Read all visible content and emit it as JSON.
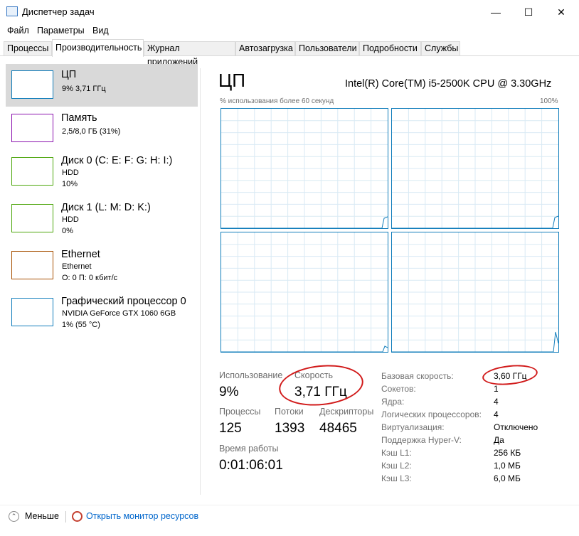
{
  "window": {
    "title": "Диспетчер задач",
    "controls": {
      "minimize": "—",
      "maximize": "☐",
      "close": "✕"
    }
  },
  "menu": [
    "Файл",
    "Параметры",
    "Вид"
  ],
  "tabs": [
    {
      "label": "Процессы",
      "active": false
    },
    {
      "label": "Производительность",
      "active": true
    },
    {
      "label": "Журнал приложений",
      "active": false
    },
    {
      "label": "Автозагрузка",
      "active": false
    },
    {
      "label": "Пользователи",
      "active": false
    },
    {
      "label": "Подробности",
      "active": false
    },
    {
      "label": "Службы",
      "active": false
    }
  ],
  "sidebar": [
    {
      "title": "ЦП",
      "lines": [
        "9% 3,71 ГГц"
      ],
      "color": "#117dbb",
      "selected": true
    },
    {
      "title": "Память",
      "lines": [
        "2,5/8,0 ГБ (31%)"
      ],
      "color": "#8b12ae",
      "selected": false
    },
    {
      "title": "Диск 0 (C: E: F: G: H: I:)",
      "lines": [
        "HDD",
        "10%"
      ],
      "color": "#4da60c",
      "selected": false
    },
    {
      "title": "Диск 1 (L: M: D: K:)",
      "lines": [
        "HDD",
        "0%"
      ],
      "color": "#4da60c",
      "selected": false
    },
    {
      "title": "Ethernet",
      "lines": [
        "Ethernet",
        "О: 0 П: 0 кбит/с"
      ],
      "color": "#a74f01",
      "selected": false
    },
    {
      "title": "Графический процессор 0",
      "lines": [
        "NVIDIA GeForce GTX 1060 6GB",
        "1% (55 °C)"
      ],
      "color": "#117dbb",
      "selected": false
    }
  ],
  "main": {
    "heading": "ЦП",
    "model": "Intel(R) Core(TM) i5-2500K CPU @ 3.30GHz",
    "graph_caption": "% использования более 60 секунд",
    "graph_max": "100%",
    "graph_color": "#117dbb",
    "graph_grid_color": "#d9eaf4",
    "stats": {
      "usage_label": "Использование",
      "usage_value": "9%",
      "speed_label": "Скорость",
      "speed_value": "3,71 ГГц",
      "processes_label": "Процессы",
      "processes_value": "125",
      "threads_label": "Потоки",
      "threads_value": "1393",
      "handles_label": "Дескрипторы",
      "handles_value": "48465",
      "uptime_label": "Время работы",
      "uptime_value": "0:01:06:01"
    },
    "details": [
      {
        "label": "Базовая скорость:",
        "value": "3,60 ГГц"
      },
      {
        "label": "Сокетов:",
        "value": "1"
      },
      {
        "label": "Ядра:",
        "value": "4"
      },
      {
        "label": "Логических процессоров:",
        "value": "4"
      },
      {
        "label": "Виртуализация:",
        "value": "Отключено"
      },
      {
        "label": "Поддержка Hyper-V:",
        "value": "Да"
      },
      {
        "label": "Кэш L1:",
        "value": "256 КБ"
      },
      {
        "label": "Кэш L2:",
        "value": "1,0 МБ"
      },
      {
        "label": "Кэш L3:",
        "value": "6,0 МБ"
      }
    ]
  },
  "footer": {
    "less_label": "Меньше",
    "resmon_label": "Открыть монитор ресурсов",
    "link_color": "#0066cc"
  },
  "annotation_color": "#d11a1a"
}
